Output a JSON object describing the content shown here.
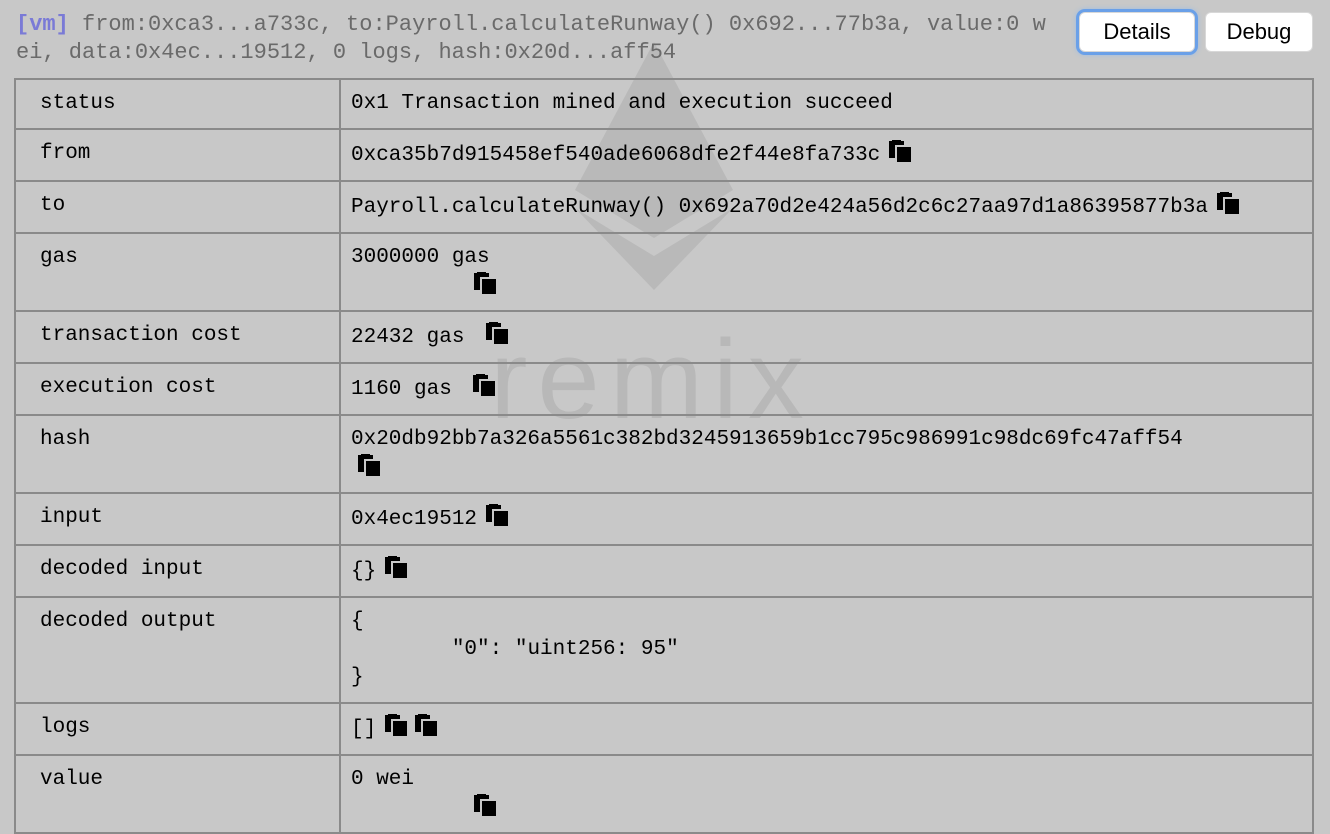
{
  "header": {
    "vm_tag": "[vm]",
    "summary": " from:0xca3...a733c, to:Payroll.calculateRunway() 0x692...77b3a, value:0 wei, data:0x4ec...19512, 0 logs, hash:0x20d...aff54"
  },
  "buttons": {
    "details": "Details",
    "debug": "Debug"
  },
  "watermark": {
    "text": "remix"
  },
  "rows": {
    "status": {
      "key": "status",
      "value": "0x1 Transaction mined and execution succeed"
    },
    "from": {
      "key": "from",
      "value": "0xca35b7d915458ef540ade6068dfe2f44e8fa733c"
    },
    "to": {
      "key": "to",
      "value": "Payroll.calculateRunway() 0x692a70d2e424a56d2c6c27aa97d1a86395877b3a"
    },
    "gas": {
      "key": "gas",
      "value": "3000000 gas"
    },
    "transaction_cost": {
      "key": "transaction cost",
      "value": "22432 gas "
    },
    "execution_cost": {
      "key": "execution cost",
      "value": "1160 gas "
    },
    "hash": {
      "key": "hash",
      "value": "0x20db92bb7a326a5561c382bd3245913659b1cc795c986991c98dc69fc47aff54"
    },
    "input": {
      "key": "input",
      "value": "0x4ec19512"
    },
    "decoded_input": {
      "key": "decoded input",
      "value": "{}"
    },
    "decoded_output": {
      "key": "decoded output",
      "value": "{\n\t\"0\": \"uint256: 95\"\n}"
    },
    "logs": {
      "key": "logs",
      "value": "[]"
    },
    "value": {
      "key": "value",
      "value": "0 wei"
    }
  },
  "icons": {
    "copy": "copy-icon",
    "watermark_logo": "ethereum-logo-icon"
  }
}
